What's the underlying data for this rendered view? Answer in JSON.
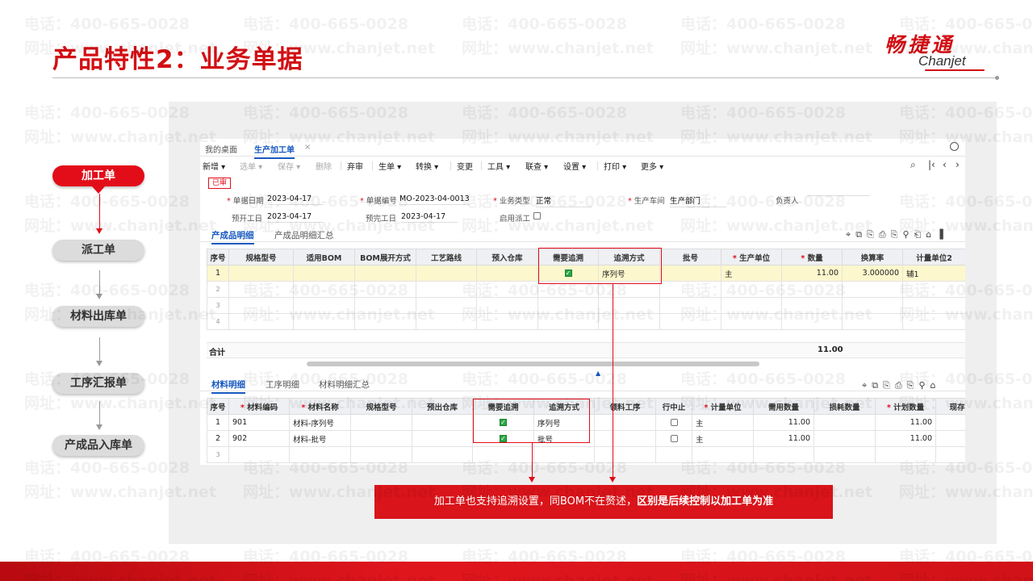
{
  "title": "产品特性2：业务单据",
  "logo": {
    "cn": "畅捷通",
    "en": "Chanjet"
  },
  "watermark": {
    "phone": "电话：400-665-0028",
    "url": "网址：www.chanjet.net"
  },
  "flow": [
    "加工单",
    "派工单",
    "材料出库单",
    "工序汇报单",
    "产成品入库单"
  ],
  "app": {
    "tabs": [
      "我的桌面",
      "生产加工单"
    ],
    "tab_close": "×",
    "toolbar": [
      "新增",
      "选单",
      "保存",
      "删除",
      "弃审",
      "生单",
      "转换",
      "变更",
      "工具",
      "联查",
      "设置",
      "打印",
      "更多"
    ],
    "status": "已审",
    "fields": {
      "doc_date_label": "单据日期",
      "doc_date": "2023-04-17",
      "doc_no_label": "单据编号",
      "doc_no": "MO-2023-04-0013",
      "biz_type_label": "业务类型",
      "biz_type": "正常",
      "workshop_label": "生产车间",
      "workshop": "生产部门",
      "owner_label": "负责人",
      "plan_start_label": "预开工日",
      "plan_start": "2023-04-17",
      "plan_end_label": "预完工日",
      "plan_end": "2023-04-17",
      "dispatch_label": "启用派工"
    },
    "product_tabs": [
      "产成品明细",
      "产成品明细汇总"
    ],
    "product_table": {
      "headers": [
        "序号",
        "规格型号",
        "适用BOM",
        "BOM展开方式",
        "工艺路线",
        "预入仓库",
        "需要追溯",
        "追溯方式",
        "批号",
        "生产单位",
        "数量",
        "换算率",
        "计量单位2"
      ],
      "rows": [
        {
          "no": "1",
          "trace_method": "序列号",
          "unit": "主",
          "qty": "11.00",
          "rate": "3.000000",
          "unit2": "辅1"
        }
      ],
      "empty_rows": [
        "2",
        "3",
        "4"
      ],
      "total_label": "合计",
      "total_qty": "11.00"
    },
    "material_tabs": [
      "材料明细",
      "工序明细",
      "材料明细汇总"
    ],
    "material_table": {
      "headers": [
        "序号",
        "材料编码",
        "材料名称",
        "规格型号",
        "预出仓库",
        "需要追溯",
        "追溯方式",
        "领料工序",
        "行中止",
        "计量单位",
        "需用数量",
        "损耗数量",
        "计划数量",
        "现存"
      ],
      "rows": [
        {
          "no": "1",
          "code": "901",
          "name": "材料-序列号",
          "trace_method": "序列号",
          "unit": "主",
          "need_qty": "11.00",
          "plan_qty": "11.00"
        },
        {
          "no": "2",
          "code": "902",
          "name": "材料-批号",
          "trace_method": "批号",
          "unit": "主",
          "need_qty": "11.00",
          "plan_qty": "11.00"
        }
      ],
      "empty_rows": [
        "3"
      ]
    }
  },
  "callout": {
    "normal": "加工单也支持追溯设置，同BOM不在赘述，",
    "bold": "区别是后续控制以加工单为准"
  },
  "colors": {
    "brand_red": "#d20f14",
    "link_blue": "#1558c0",
    "highlight_row": "#fdf7cd",
    "check_green": "#2aa845"
  },
  "icons": [
    "search-icon",
    "locate-icon",
    "copy-icon",
    "paste-icon",
    "insert-icon",
    "filter-icon",
    "export-icon",
    "settings-icon"
  ]
}
